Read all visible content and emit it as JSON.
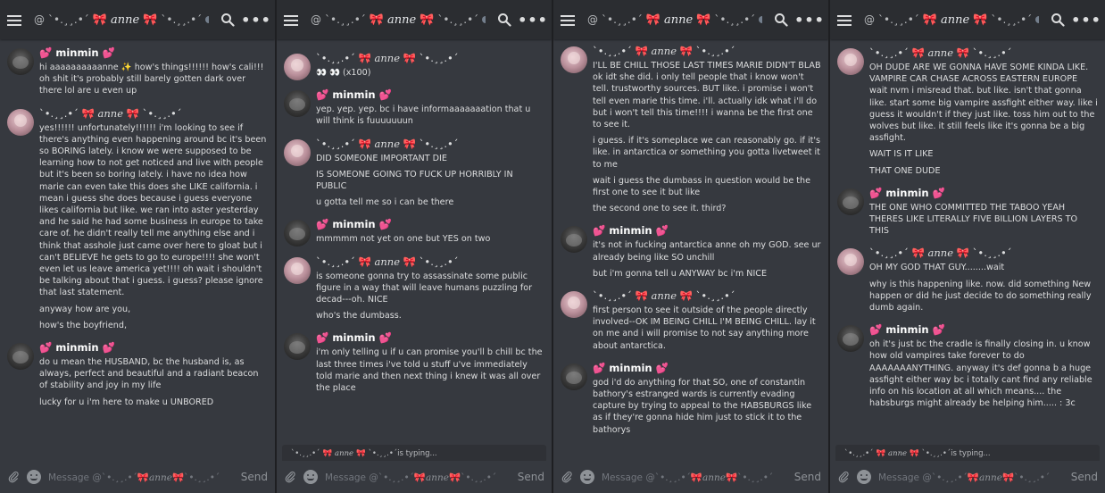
{
  "channel": {
    "prefix": "@",
    "left_deco": "`•.¸¸.•´",
    "bow": "🎀",
    "name": "anne",
    "right_deco": "`•.¸¸.•´"
  },
  "composer": {
    "placeholder_prefix": "Message @",
    "send_label": "Send"
  },
  "typing_suffix": "is typing...",
  "panels": [
    {
      "typing": false,
      "offset": 8,
      "groups": [
        {
          "user": "minmin",
          "messages": [
            "hi aaaaaaaaaanne ✨ how's things!!!!!! how's cali!!! oh shit it's probably still barely gotten dark over there lol are u even up"
          ]
        },
        {
          "user": "anne",
          "messages": [
            "yes!!!!!! unfortunately!!!!!! i'm looking to see if there's anything even happening around bc it's been so BORING lately. i know we were supposed to be learning how to not get noticed and live with people but it's been so boring lately. i have no idea how marie can even take this does she LIKE california. i mean i guess she does because i guess everyone likes california but like. we ran into aster yesterday and he said he had some business in europe to take care of. he didn't really tell me anything else and i think that asshole just came over here to gloat but i can't BELIEVE he gets to go to europe!!!! she won't even let us leave america yet!!!! oh wait i shouldn't be talking about that i guess. i guess? please ignore that last statement.",
            "anyway  how are you,",
            "how's the boyfriend,"
          ]
        },
        {
          "user": "minmin",
          "messages": [
            "do u mean the HUSBAND, bc the husband is, as always, perfect and beautiful and a radiant beacon of stability and joy in my life",
            "lucky for u i'm here to make u UNBORED"
          ]
        }
      ]
    },
    {
      "typing": true,
      "offset": 14,
      "groups": [
        {
          "user": "anne",
          "messages": [
            "👀 👀 (x100)"
          ]
        },
        {
          "user": "minmin",
          "messages": [
            "yep. yep. yep. bc i have informaaaaaaation that u will think is fuuuuuuun"
          ]
        },
        {
          "user": "anne",
          "messages": [
            "DID SOMEONE IMPORTANT DIE",
            "IS SOMEONE GOING TO FUCK UP HORRIBLY IN PUBLIC",
            "u gotta tell me so i can be there"
          ]
        },
        {
          "user": "minmin",
          "messages": [
            "mmmmm not yet on one but YES on two"
          ]
        },
        {
          "user": "anne",
          "messages": [
            "is someone gonna try to assassinate some public figure in a way that will leave humans puzzling for decad---oh. NICE",
            "who's the dumbass."
          ]
        },
        {
          "user": "minmin",
          "messages": [
            "i'm only telling u if u can promise you'll b chill bc the last three times i've told u stuff u've immediately told marie and then next thing i knew it was all over the place"
          ]
        }
      ]
    },
    {
      "typing": false,
      "offset": 6,
      "groups": [
        {
          "user": "anne",
          "messages": [
            "I'LL BE CHILL THOSE LAST TIMES MARIE DIDN'T BLAB ok idt she did. i only tell people that i know won't tell. trustworthy sources. BUT like. i promise i won't tell even marie this time. i'll. actually idk what i'll do but i won't tell this time!!!! i wanna be the first one to see it.",
            "i guess. if it's someplace we can reasonably go. if it's like. in antarctica or something you gotta livetweet it to me",
            "wait i guess the dumbass in question would be the first one to see it but like",
            "the second one to see it. third?"
          ]
        },
        {
          "user": "minmin",
          "messages": [
            "it's not in fucking antarctica anne oh my GOD. see ur already being like SO unchill",
            "but i'm gonna tell u ANYWAY bc i'm NICE"
          ]
        },
        {
          "user": "anne",
          "messages": [
            "first person to see it outside of the people directly involved--OK IM BEING CHILL I'M BEING CHILL. lay it on me and i will promise to not say anything more about antarctica."
          ]
        },
        {
          "user": "minmin",
          "messages": [
            "god i'd do anything for that SO, one of constantin bathory's estranged wards is currently evading capture by trying to appeal to the HABSBURGS like as if they're gonna hide him just to stick it to the bathorys"
          ]
        }
      ]
    },
    {
      "typing": true,
      "offset": 8,
      "groups": [
        {
          "user": "anne",
          "messages": [
            "OH DUDE ARE WE GONNA HAVE SOME KINDA LIKE. VAMPIRE CAR CHASE ACROSS EASTERN EUROPE wait nvm i misread that. but like. isn't that gonna like. start some big vampire assfight either way. like i guess it wouldn't if they just like. toss him out to the wolves but like. it still feels like it's gonna be a big assfight.",
            "WAIT IS IT LIKE",
            "THAT ONE DUDE"
          ]
        },
        {
          "user": "minmin",
          "messages": [
            "THE ONE WHO COMMITTED THE TABOO YEAH THERES LIKE LITERALLY FIVE BILLION LAYERS TO THIS"
          ]
        },
        {
          "user": "anne",
          "messages": [
            "OH MY GOD THAT GUY........wait",
            "why is this happening like. now. did something New happen or did he just decide to do something really dumb again."
          ]
        },
        {
          "user": "minmin",
          "messages": [
            "oh it's just bc the cradle is finally closing in. u know how old vampires take forever to do AAAAAAANYTHING. anyway it's def gonna b a huge assfight either way bc i totally cant find any reliable info on his location at all which means.... the habsburgs might already be helping him..... : 3c"
          ]
        }
      ]
    }
  ]
}
